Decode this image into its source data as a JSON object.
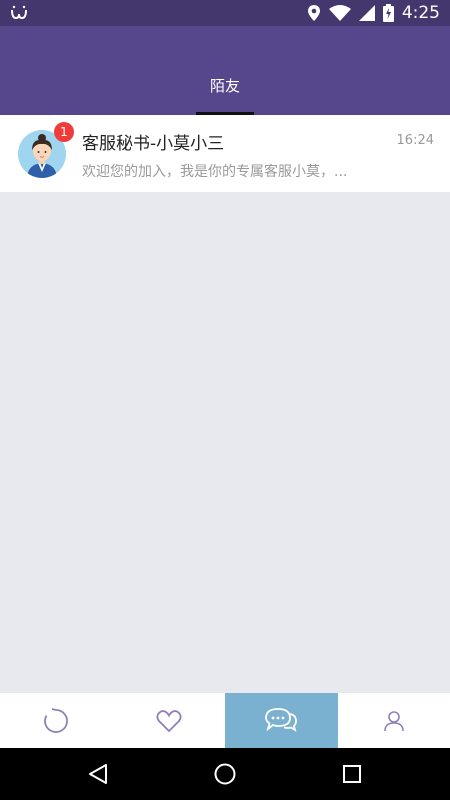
{
  "status_bar": {
    "time": "4:25",
    "icons": [
      "app-notification-icon",
      "location-icon",
      "wifi-icon",
      "signal-icon",
      "battery-charging-icon"
    ]
  },
  "header": {
    "tabs": [
      {
        "label": "陌友",
        "active": true
      }
    ]
  },
  "conversations": [
    {
      "title": "客服秘书-小莫小三",
      "time": "16:24",
      "preview": "欢迎您的加入，我是你的专属客服小莫，...",
      "unread": "1",
      "avatar": "customer-service-avatar"
    }
  ],
  "bottom_nav": {
    "items": [
      {
        "icon": "refresh-icon"
      },
      {
        "icon": "heart-icon"
      },
      {
        "icon": "chat-icon",
        "active": true
      },
      {
        "icon": "user-icon"
      }
    ],
    "active_color": "#7ab0d0"
  },
  "system_nav": [
    "back-icon",
    "home-icon",
    "recents-icon"
  ],
  "colors": {
    "header": "#56468c",
    "status_bar": "#44376e",
    "badge": "#f03b3b",
    "background": "#e8e9ee"
  }
}
